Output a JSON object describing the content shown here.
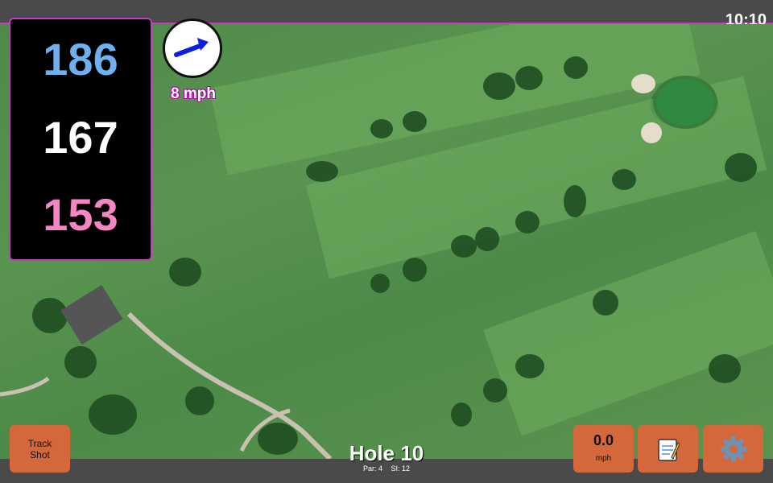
{
  "status": {
    "time": "10:10"
  },
  "yardages": {
    "back": "186",
    "middle": "167",
    "front": "153"
  },
  "wind": {
    "speed": "8 mph",
    "icon": "wind-arrow-icon"
  },
  "hole": {
    "title": "Hole 10",
    "par": "Par: 4",
    "stroke_index": "SI: 12"
  },
  "buttons": {
    "track_shot_line1": "Track",
    "track_shot_line2": "Shot",
    "speed_value": "0.0",
    "speed_unit": "mph",
    "notes_icon": "notepad-icon",
    "settings_icon": "gear-icon"
  },
  "colors": {
    "back_yardage": "#6fb1f0",
    "middle_yardage": "#ffffff",
    "front_yardage": "#f486c4",
    "button": "#d4683a",
    "accent_border": "#c23cc4"
  }
}
